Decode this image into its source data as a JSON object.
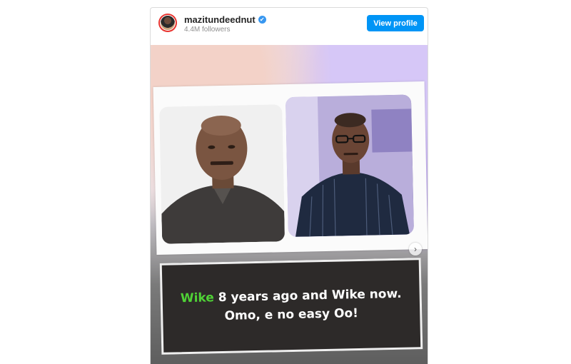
{
  "header": {
    "username": "mazitundeednut",
    "verified_mark": "✔",
    "followers": "4.4M followers",
    "view_profile_label": "View profile"
  },
  "post": {
    "caption_highlight": "Wike",
    "caption_line1_rest": " 8 years ago and Wike now.",
    "caption_line2": "Omo, e no easy Oo!",
    "next_arrow": "›"
  },
  "colors": {
    "accent": "#0095f6",
    "highlight": "#4fd136",
    "caption_bg": "#2d2a29"
  },
  "icons": {
    "verified": "verified-badge-icon",
    "next": "chevron-right-icon"
  }
}
